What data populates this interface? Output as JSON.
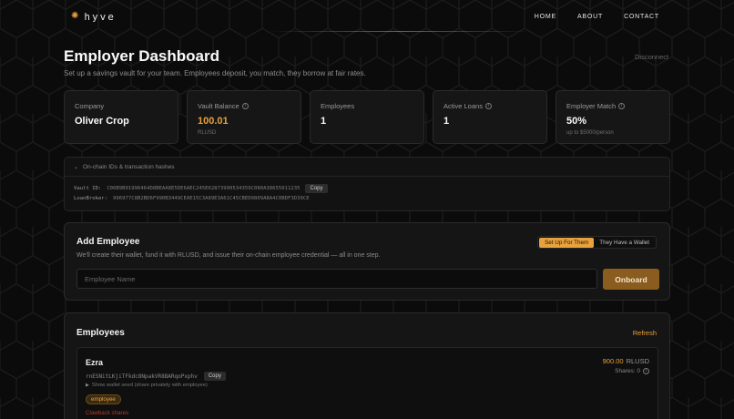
{
  "nav": {
    "brand": "hyve",
    "links": [
      "HOME",
      "ABOUT",
      "CONTACT"
    ]
  },
  "header": {
    "title": "Employer Dashboard",
    "subtitle": "Set up a savings vault for your team. Employees deposit, you match, they borrow at fair rates.",
    "disconnect": "Disconnect"
  },
  "stats": [
    {
      "label": "Company",
      "value": "Oliver Crop",
      "sub": ""
    },
    {
      "label": "Vault Balance",
      "value": "100.01",
      "sub": "RLUSD"
    },
    {
      "label": "Employees",
      "value": "1",
      "sub": ""
    },
    {
      "label": "Active Loans",
      "value": "1",
      "sub": ""
    },
    {
      "label": "Employer Match",
      "value": "50%",
      "sub": "up to $5000/person"
    }
  ],
  "chain": {
    "toggle_label": "On-chain IDs & transaction hashes",
    "vault_key": "Vault ID:",
    "vault_id": "C06B9B91996464D8BEAA8E5DE6AEC245E62873990534359C080A38655011235",
    "copy_label": "Copy",
    "broker_key": "LoanBroker:",
    "broker_id": "996977C8B2BD6F990B3449CEAE15C3A89E3A61C45CBED0809A8A4C0BDF3D39CE"
  },
  "add_employee": {
    "title": "Add Employee",
    "description": "We'll create their wallet, fund it with RLUSD, and issue their on-chain employee credential — all in one step.",
    "toggle": [
      "Set Up For Them",
      "They Have a Wallet"
    ],
    "input_placeholder": "Employee Name",
    "button": "Onboard"
  },
  "employees": {
    "title": "Employees",
    "refresh": "Refresh",
    "items": [
      {
        "name": "Ezra",
        "address": "rnESNitLKjiTFkdc8NpakVR8BARqoPxphv",
        "copy_label": "Copy",
        "seed_toggle": "Show wallet seed (share privately with employee)",
        "badge": "employee",
        "clawback": "Clawback shares",
        "balance": "900.00",
        "currency": "RLUSD",
        "shares": "Shares: 0"
      }
    ]
  },
  "colors": {
    "accent": "#e8a13c",
    "background": "#0b0b0b",
    "panel": "#151515",
    "danger": "#b03a2e"
  },
  "icons": [
    "hexagon-logo-icon",
    "info-icon",
    "chevron-down-icon",
    "triangle-right-icon"
  ]
}
